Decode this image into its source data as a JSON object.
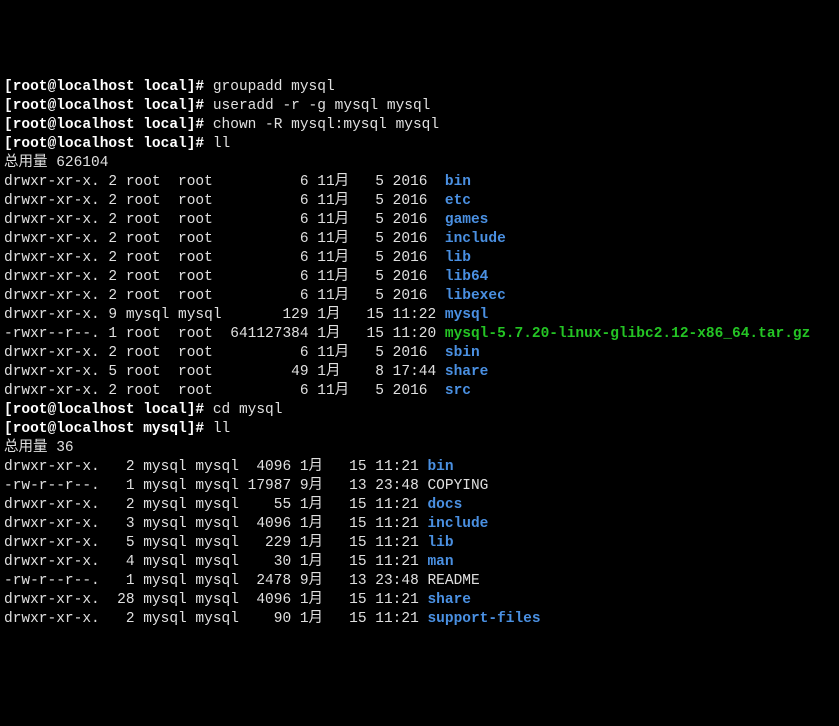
{
  "prompt_local": "[root@localhost local]# ",
  "prompt_mysql": "[root@localhost mysql]# ",
  "cmds": {
    "groupadd": "groupadd mysql",
    "useradd": "useradd -r -g mysql mysql",
    "chown": "chown -R mysql:mysql mysql",
    "ll1": "ll",
    "cd": "cd mysql",
    "ll2": "ll"
  },
  "totals": {
    "local": "总用量 626104",
    "mysql": "总用量 36"
  },
  "ls_local": [
    {
      "perm": "drwxr-xr-x.",
      "ln": "2",
      "u": "root ",
      "g": "root ",
      "sz": "        6",
      "m": "11月",
      "d": "  5",
      "t": "2016 ",
      "name": "bin",
      "cls": "blue"
    },
    {
      "perm": "drwxr-xr-x.",
      "ln": "2",
      "u": "root ",
      "g": "root ",
      "sz": "        6",
      "m": "11月",
      "d": "  5",
      "t": "2016 ",
      "name": "etc",
      "cls": "blue"
    },
    {
      "perm": "drwxr-xr-x.",
      "ln": "2",
      "u": "root ",
      "g": "root ",
      "sz": "        6",
      "m": "11月",
      "d": "  5",
      "t": "2016 ",
      "name": "games",
      "cls": "blue"
    },
    {
      "perm": "drwxr-xr-x.",
      "ln": "2",
      "u": "root ",
      "g": "root ",
      "sz": "        6",
      "m": "11月",
      "d": "  5",
      "t": "2016 ",
      "name": "include",
      "cls": "blue"
    },
    {
      "perm": "drwxr-xr-x.",
      "ln": "2",
      "u": "root ",
      "g": "root ",
      "sz": "        6",
      "m": "11月",
      "d": "  5",
      "t": "2016 ",
      "name": "lib",
      "cls": "blue"
    },
    {
      "perm": "drwxr-xr-x.",
      "ln": "2",
      "u": "root ",
      "g": "root ",
      "sz": "        6",
      "m": "11月",
      "d": "  5",
      "t": "2016 ",
      "name": "lib64",
      "cls": "blue"
    },
    {
      "perm": "drwxr-xr-x.",
      "ln": "2",
      "u": "root ",
      "g": "root ",
      "sz": "        6",
      "m": "11月",
      "d": "  5",
      "t": "2016 ",
      "name": "libexec",
      "cls": "blue"
    },
    {
      "perm": "drwxr-xr-x.",
      "ln": "9",
      "u": "mysql",
      "g": "mysql",
      "sz": "      129",
      "m": "1月 ",
      "d": " 15",
      "t": "11:22",
      "name": "mysql",
      "cls": "blue"
    },
    {
      "perm": "-rwxr--r--.",
      "ln": "1",
      "u": "root ",
      "g": "root ",
      "sz": "641127384",
      "m": "1月 ",
      "d": " 15",
      "t": "11:20",
      "name": "mysql-5.7.20-linux-glibc2.12-x86_64.tar.gz",
      "cls": "green"
    },
    {
      "perm": "drwxr-xr-x.",
      "ln": "2",
      "u": "root ",
      "g": "root ",
      "sz": "        6",
      "m": "11月",
      "d": "  5",
      "t": "2016 ",
      "name": "sbin",
      "cls": "blue"
    },
    {
      "perm": "drwxr-xr-x.",
      "ln": "5",
      "u": "root ",
      "g": "root ",
      "sz": "       49",
      "m": "1月 ",
      "d": "  8",
      "t": "17:44",
      "name": "share",
      "cls": "blue"
    },
    {
      "perm": "drwxr-xr-x.",
      "ln": "2",
      "u": "root ",
      "g": "root ",
      "sz": "        6",
      "m": "11月",
      "d": "  5",
      "t": "2016 ",
      "name": "src",
      "cls": "blue"
    }
  ],
  "ls_mysql": [
    {
      "perm": "drwxr-xr-x. ",
      "ln": " 2",
      "u": "mysql",
      "g": "mysql",
      "sz": " 4096",
      "m": "1月",
      "d": " 15",
      "t": "11:21",
      "name": "bin",
      "cls": "blue"
    },
    {
      "perm": "-rw-r--r--. ",
      "ln": " 1",
      "u": "mysql",
      "g": "mysql",
      "sz": "17987",
      "m": "9月",
      "d": " 13",
      "t": "23:48",
      "name": "COPYING",
      "cls": "dim"
    },
    {
      "perm": "drwxr-xr-x. ",
      "ln": " 2",
      "u": "mysql",
      "g": "mysql",
      "sz": "   55",
      "m": "1月",
      "d": " 15",
      "t": "11:21",
      "name": "docs",
      "cls": "blue"
    },
    {
      "perm": "drwxr-xr-x. ",
      "ln": " 3",
      "u": "mysql",
      "g": "mysql",
      "sz": " 4096",
      "m": "1月",
      "d": " 15",
      "t": "11:21",
      "name": "include",
      "cls": "blue"
    },
    {
      "perm": "drwxr-xr-x. ",
      "ln": " 5",
      "u": "mysql",
      "g": "mysql",
      "sz": "  229",
      "m": "1月",
      "d": " 15",
      "t": "11:21",
      "name": "lib",
      "cls": "blue"
    },
    {
      "perm": "drwxr-xr-x. ",
      "ln": " 4",
      "u": "mysql",
      "g": "mysql",
      "sz": "   30",
      "m": "1月",
      "d": " 15",
      "t": "11:21",
      "name": "man",
      "cls": "blue"
    },
    {
      "perm": "-rw-r--r--. ",
      "ln": " 1",
      "u": "mysql",
      "g": "mysql",
      "sz": " 2478",
      "m": "9月",
      "d": " 13",
      "t": "23:48",
      "name": "README",
      "cls": "dim"
    },
    {
      "perm": "drwxr-xr-x. ",
      "ln": "28",
      "u": "mysql",
      "g": "mysql",
      "sz": " 4096",
      "m": "1月",
      "d": " 15",
      "t": "11:21",
      "name": "share",
      "cls": "blue"
    },
    {
      "perm": "drwxr-xr-x. ",
      "ln": " 2",
      "u": "mysql",
      "g": "mysql",
      "sz": "   90",
      "m": "1月",
      "d": " 15",
      "t": "11:21",
      "name": "support-files",
      "cls": "blue"
    }
  ]
}
